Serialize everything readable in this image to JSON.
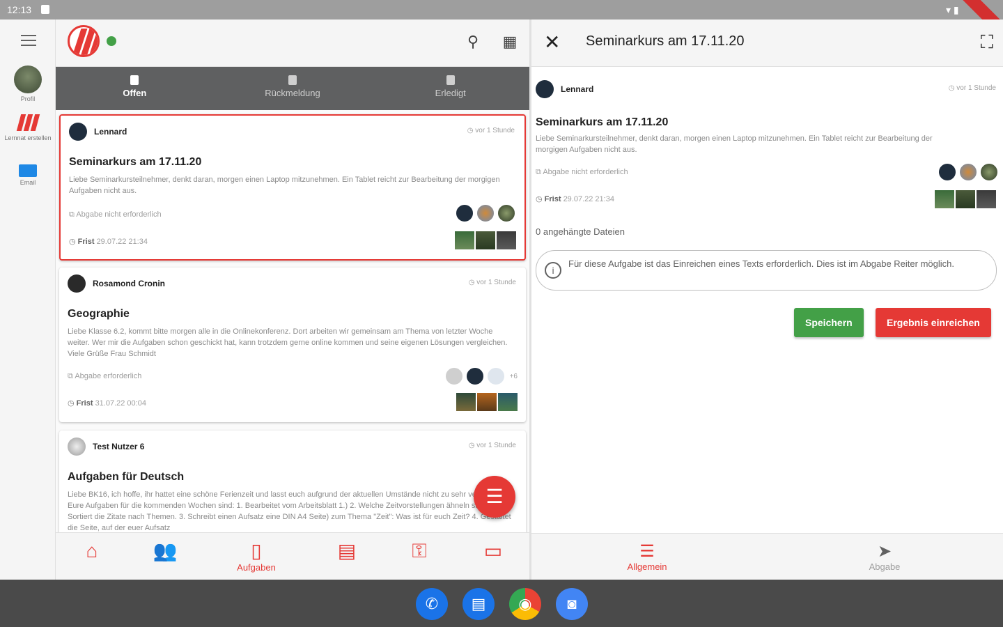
{
  "status_bar": {
    "time": "12:13"
  },
  "rail": {
    "items": [
      {
        "label": "Profil",
        "icon": "profile-avatar"
      },
      {
        "label": "Lernnat erstellen",
        "icon": "app-logo"
      },
      {
        "label": "Email",
        "icon": "mail-icon"
      }
    ]
  },
  "tabs": [
    {
      "label": "Offen",
      "icon": "inbox-icon",
      "active": true
    },
    {
      "label": "Rückmeldung",
      "icon": "hourglass-icon",
      "active": false
    },
    {
      "label": "Erledigt",
      "icon": "archive-icon",
      "active": false
    }
  ],
  "cards": [
    {
      "author": "Lennard",
      "time_ago": "vor 1 Stunde",
      "title": "Seminarkurs am 17.11.20",
      "description": "Liebe Seminarkursteilnehmer, denkt daran, morgen einen Laptop mitzunehmen. Ein Tablet reicht zur Bearbeitung der morgigen Aufgaben nicht aus.",
      "submission": "Abgabe nicht erforderlich",
      "deadline_label": "Frist",
      "deadline": "29.07.22 21:34",
      "extra": ""
    },
    {
      "author": "Rosamond Cronin",
      "time_ago": "vor 1 Stunde",
      "title": "Geographie",
      "description": "Liebe Klasse 6.2, kommt bitte morgen alle in die Onlinekonferenz. Dort arbeiten wir gemeinsam am Thema von letzter Woche weiter. Wer mir die Aufgaben schon geschickt hat, kann trotzdem gerne online kommen und seine eigenen Lösungen vergleichen. Viele Grüße Frau Schmidt",
      "submission": "Abgabe erforderlich",
      "deadline_label": "Frist",
      "deadline": "31.07.22 00:04",
      "extra": "+6"
    },
    {
      "author": "Test Nutzer 6",
      "time_ago": "vor 1 Stunde",
      "title": "Aufgaben für Deutsch",
      "description": "Liebe BK16, ich hoffe, ihr hattet eine schöne Ferienzeit und lasst euch aufgrund der aktuellen Umstände nicht zu sehr verunsichern. Eure Aufgaben für die kommenden Wochen sind: 1. Bearbeitet vom Arbeitsblatt 1.) 2. Welche Zeitvorstellungen ähneln sich? Sortiert die Zitate nach Themen. 3. Schreibt einen Aufsatz eine DIN A4 Seite) zum Thema \"Zeit\": Was ist für euch Zeit? 4. Gestaltet die Seite, auf der euer Aufsatz",
      "submission": "",
      "deadline_label": "",
      "deadline": "",
      "extra": ""
    }
  ],
  "bottom_nav": [
    {
      "label": "",
      "icon": "home-icon"
    },
    {
      "label": "",
      "icon": "people-icon"
    },
    {
      "label": "Aufgaben",
      "icon": "clipboard-icon"
    },
    {
      "label": "",
      "icon": "calendar-icon"
    },
    {
      "label": "",
      "icon": "badge-icon"
    },
    {
      "label": "",
      "icon": "monitor-icon"
    }
  ],
  "detail": {
    "header_title": "Seminarkurs am 17.11.20",
    "author": "Lennard",
    "time_ago": "vor 1 Stunde",
    "title": "Seminarkurs am 17.11.20",
    "description": "Liebe Seminarkursteilnehmer, denkt daran, morgen einen Laptop mitzunehmen. Ein Tablet reicht zur Bearbeitung der morgigen Aufgaben nicht aus.",
    "submission": "Abgabe nicht erforderlich",
    "deadline_label": "Frist",
    "deadline": "29.07.22 21:34",
    "attached_files": "0 angehängte Dateien",
    "hint": "Für diese Aufgabe ist das Einreichen eines Texts erforderlich. Dies ist im Abgabe Reiter möglich.",
    "save_label": "Speichern",
    "submit_label": "Ergebnis einreichen",
    "tabs": [
      {
        "label": "Allgemein",
        "icon": "list-icon",
        "active": true
      },
      {
        "label": "Abgabe",
        "icon": "send-icon",
        "active": false
      }
    ]
  },
  "colors": {
    "accent": "#e53935",
    "success": "#43a047",
    "tabbar": "#5f6061"
  }
}
